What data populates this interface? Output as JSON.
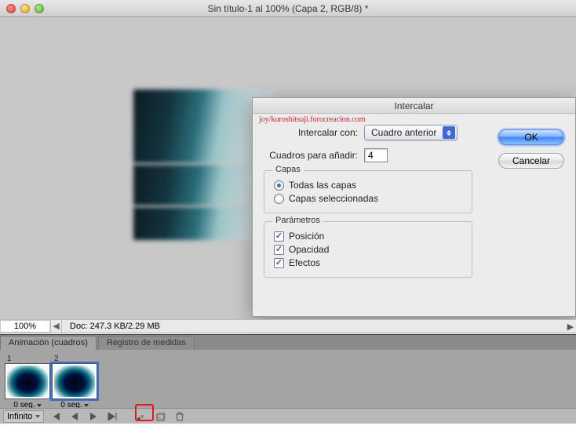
{
  "window": {
    "title": "Sin título-1 al 100% (Capa 2, RGB/8) *"
  },
  "dialog": {
    "title": "Intercalar",
    "watermark": "joy/kuroshitsuji.forocreacion.com",
    "tween_with_label": "Intercalar con:",
    "tween_with_value": "Cuadro anterior",
    "frames_label": "Cuadros para añadir:",
    "frames_value": "4",
    "layers": {
      "legend": "Capas",
      "all": "Todas las capas",
      "selected_only": "Capas seleccionadas",
      "choice": "all"
    },
    "params": {
      "legend": "Parámetros",
      "position": "Posición",
      "opacity": "Opacidad",
      "effects": "Efectos",
      "position_checked": true,
      "opacity_checked": true,
      "effects_checked": true
    },
    "ok": "OK",
    "cancel": "Cancelar"
  },
  "status": {
    "zoom": "100%",
    "docinfo": "Doc: 247.3 KB/2.29 MB"
  },
  "panels": {
    "tab_animation": "Animación (cuadros)",
    "tab_measure": "Registro de medidas"
  },
  "animation": {
    "frames": [
      {
        "index": "1",
        "delay": "0 seg."
      },
      {
        "index": "2",
        "delay": "0 seg."
      }
    ],
    "loop": "Infinito"
  }
}
